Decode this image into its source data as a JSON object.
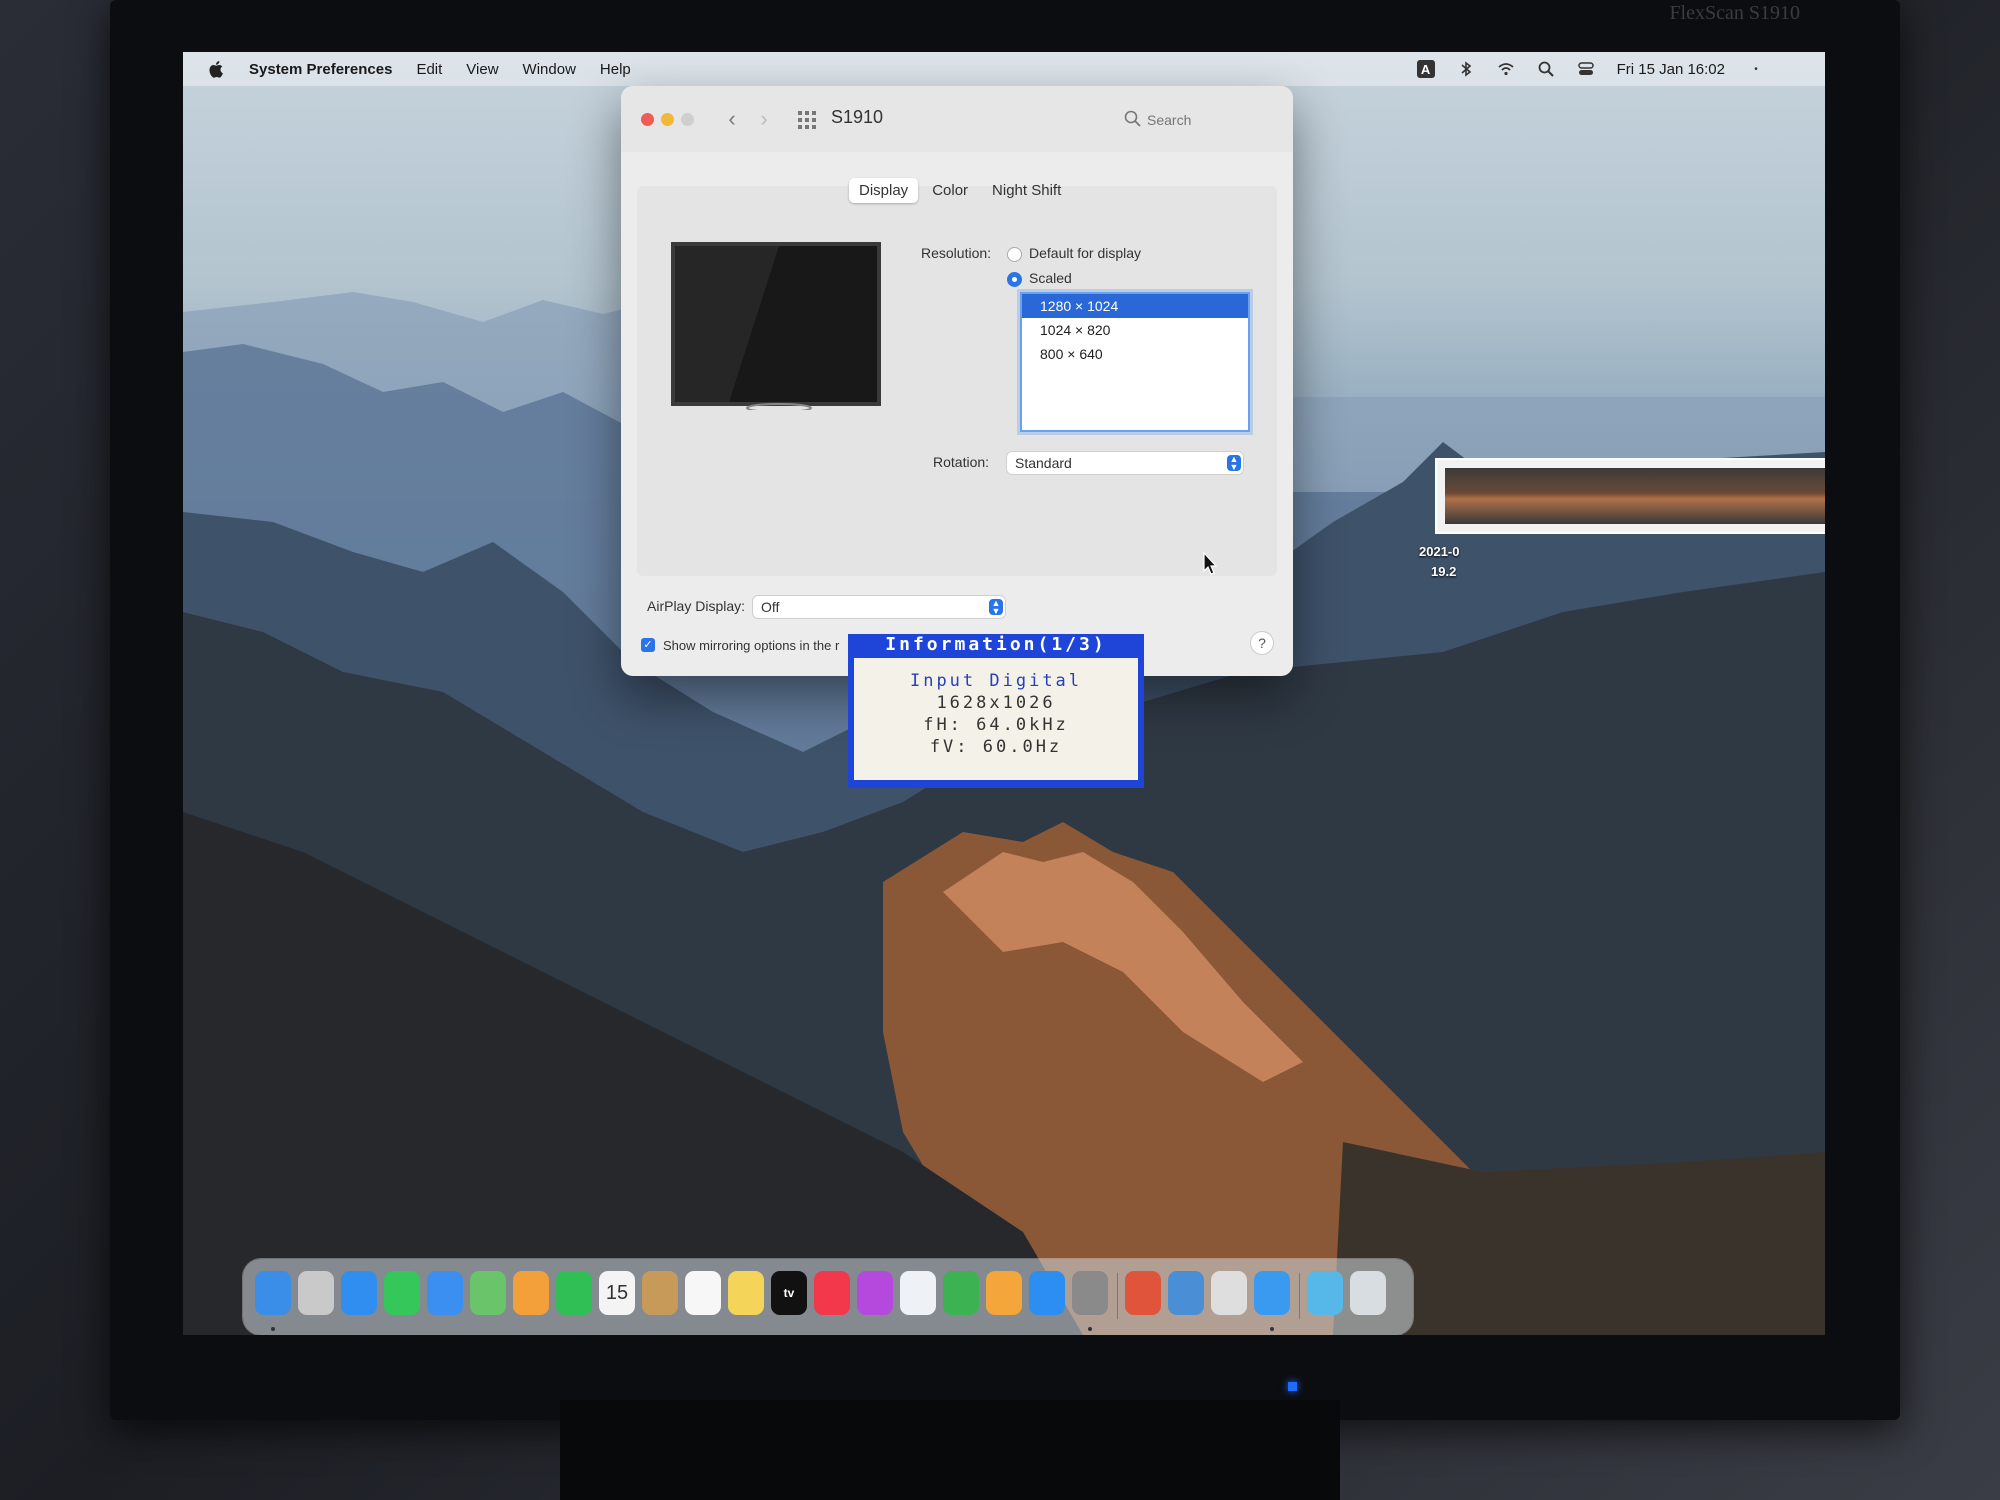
{
  "menubar": {
    "app_name": "System Preferences",
    "items": [
      "Edit",
      "View",
      "Window",
      "Help"
    ],
    "clock": "Fri 15 Jan 16:02",
    "input_badge": "A"
  },
  "window": {
    "title": "S1910",
    "search_placeholder": "Search",
    "tabs": [
      "Display",
      "Color",
      "Night Shift"
    ],
    "resolution_label": "Resolution:",
    "option_default": "Default for display",
    "option_scaled": "Scaled",
    "resolutions": [
      "1280 × 1024",
      "1024 × 820",
      "800 × 640"
    ],
    "rotation_label": "Rotation:",
    "rotation_value": "Standard",
    "airplay_label": "AirPlay Display:",
    "airplay_value": "Off",
    "mirroring_label": "Show mirroring options in the r",
    "help": "?"
  },
  "osd": {
    "title": "Information(1/3)",
    "input": "Input Digital",
    "resolution": "1628x1026",
    "fh": "fH: 64.0kHz",
    "fv": "fV: 60.0Hz"
  },
  "desktop_file": {
    "label_line1": "2021-0",
    "label_line2": "19.2"
  },
  "monitor_brand": "FlexScan S1910",
  "dock": {
    "calendar_day": "15",
    "tv_label": "tv",
    "apps": [
      {
        "name": "finder",
        "color": "#3b8ee8"
      },
      {
        "name": "launchpad",
        "color": "#c9c9c9"
      },
      {
        "name": "safari",
        "color": "#2f8ef0"
      },
      {
        "name": "messages",
        "color": "#35c759"
      },
      {
        "name": "mail",
        "color": "#3a8ff0"
      },
      {
        "name": "maps",
        "color": "#6ac46a"
      },
      {
        "name": "photos",
        "color": "#f3a03a"
      },
      {
        "name": "facetime",
        "color": "#2fbf55"
      },
      {
        "name": "calendar",
        "color": "#f4f4f4"
      },
      {
        "name": "contacts",
        "color": "#c89a5a"
      },
      {
        "name": "reminders",
        "color": "#f7f7f7"
      },
      {
        "name": "notes",
        "color": "#f4d55a"
      },
      {
        "name": "tv",
        "color": "#111111"
      },
      {
        "name": "music",
        "color": "#f3384c"
      },
      {
        "name": "podcasts",
        "color": "#b548dd"
      },
      {
        "name": "keynote",
        "color": "#eef2f6"
      },
      {
        "name": "numbers",
        "color": "#3cb253"
      },
      {
        "name": "pages",
        "color": "#f5a63a"
      },
      {
        "name": "app-store",
        "color": "#2b8ef0"
      },
      {
        "name": "system-preferences",
        "color": "#8a8a8a"
      },
      {
        "name": "color-picker",
        "color": "#e0543c"
      },
      {
        "name": "preview",
        "color": "#4a8fd6"
      },
      {
        "name": "installer",
        "color": "#dedede"
      },
      {
        "name": "safari-2",
        "color": "#3a9af0"
      },
      {
        "name": "folder",
        "color": "#56b8e8"
      },
      {
        "name": "trash",
        "color": "#d8dde2"
      }
    ]
  }
}
